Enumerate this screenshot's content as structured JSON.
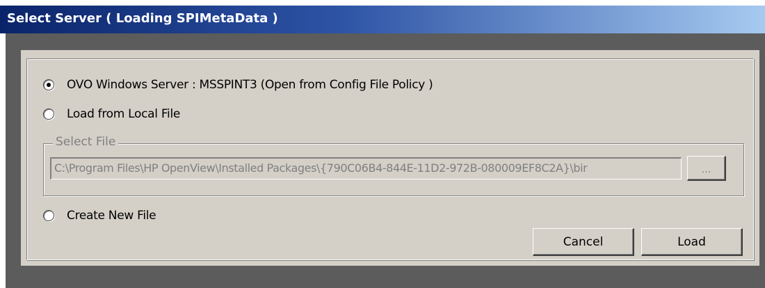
{
  "window": {
    "title": "Select Server ( Loading SPIMetaData )"
  },
  "options": {
    "server_label": "OVO Windows Server : MSSPINT3 (Open from Config File Policy )",
    "local_file_label": "Load from Local File",
    "create_new_label": "Create New File",
    "selected": "server"
  },
  "select_file": {
    "legend": "Select File",
    "path_value": "C:\\Program Files\\HP OpenView\\Installed Packages\\{790C06B4-844E-11D2-972B-080009EF8C2A}\\bir",
    "browse_label": "..."
  },
  "buttons": {
    "cancel_label": "Cancel",
    "load_label": "Load"
  },
  "colors": {
    "dialog_face": "#d4d0c8",
    "title_gradient_start": "#0a246a",
    "title_gradient_end": "#a6caf0",
    "disabled_text": "#808080"
  }
}
